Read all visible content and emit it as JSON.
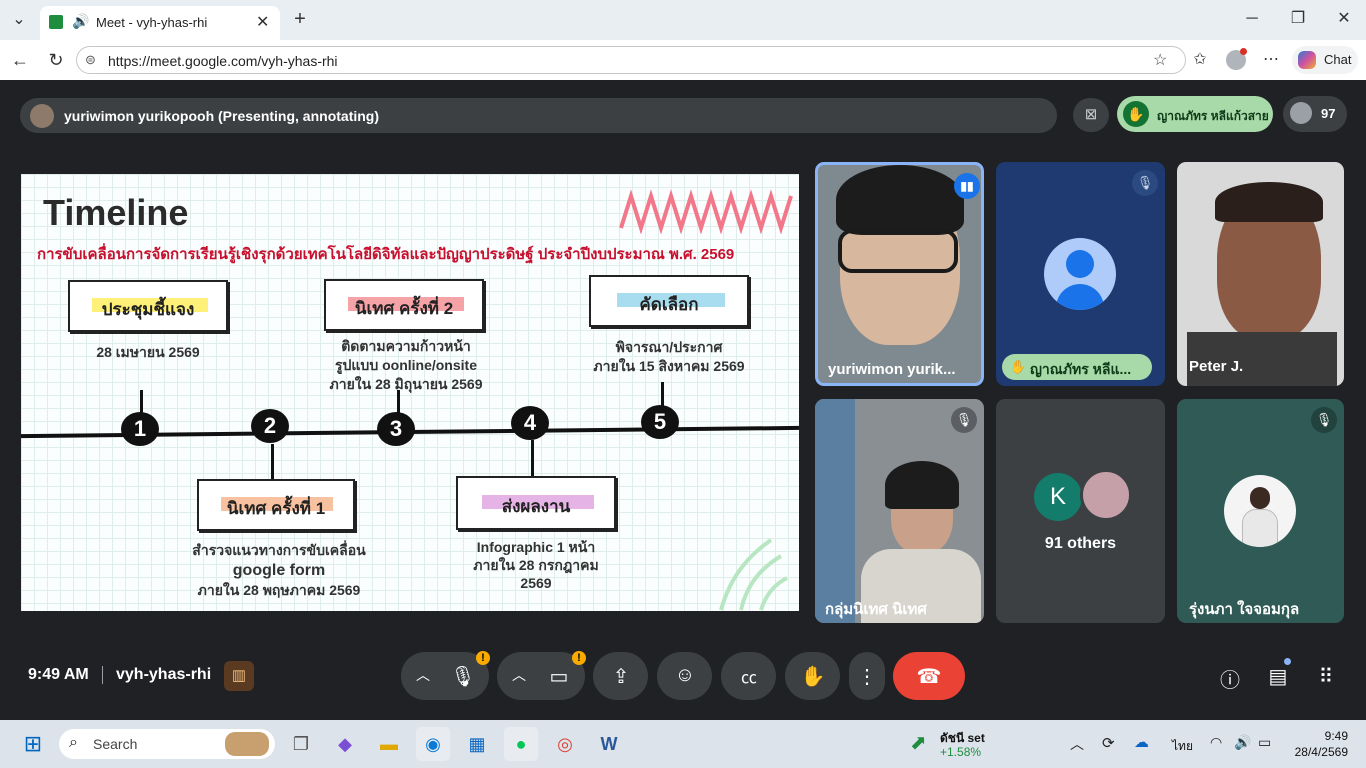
{
  "browser": {
    "tab_title": "Meet - vyh-yhas-rhi",
    "url": "https://meet.google.com/vyh-yhas-rhi",
    "chat_label": "Chat"
  },
  "meet": {
    "presenter": "yuriwimon yurikopooh (Presenting, annotating)",
    "hand_raised_name": "ญาณภัทร หลีแก้วสาย",
    "participant_count": "97",
    "time": "9:49 AM",
    "meeting_code": "vyh-yhas-rhi"
  },
  "slide": {
    "title": "Timeline",
    "subtitle": "การขับเคลื่อนการจัดการเรียนรู้เชิงรุกด้วยเทคโนโลยีดิจิทัลและปัญญาประดิษฐ์ ประจำปีงบประมาณ พ.ศ. 2569",
    "steps": [
      {
        "num": "1",
        "title": "ประชุมชี้แจง",
        "lines": [
          "28 เมษายน 2569"
        ]
      },
      {
        "num": "2",
        "title": "นิเทศ ครั้งที่ 1",
        "lines": [
          "สำรวจแนวทางการขับเคลื่อน",
          "google form",
          "ภายใน 28 พฤษภาคม 2569"
        ]
      },
      {
        "num": "3",
        "title": "นิเทศ ครั้งที่ 2",
        "lines": [
          "ติดตามความก้าวหน้า",
          "รูปแบบ oonline/onsite",
          "ภายใน 28 มิถุนายน 2569"
        ]
      },
      {
        "num": "4",
        "title": "ส่งผลงาน",
        "lines": [
          "Infographic 1 หน้า",
          "ภายใน 28 กรกฎาคม",
          "2569"
        ]
      },
      {
        "num": "5",
        "title": "คัดเลือก",
        "lines": [
          "พิจารณา/ประกาศ",
          "ภายใน 15 สิงหาคม 2569"
        ]
      }
    ],
    "colors": {
      "title_red": "#c8102e",
      "hl_yellow": "#fff07a",
      "hl_pink": "#f6a3a8",
      "hl_blue": "#a8dcef",
      "hl_purple": "#e6b3e6",
      "hl_orange": "#f8c2a0"
    }
  },
  "tiles": [
    {
      "name": "yuriwimon yurik...",
      "state": "speaking"
    },
    {
      "name": "ญาณภัทร หลีแ...",
      "state": "hand-raised",
      "avatar": "person-avatar-icon"
    },
    {
      "name": "Peter J.",
      "state": "camera"
    },
    {
      "name": "กลุ่มนิเทศ นิเทศ",
      "state": "muted"
    },
    {
      "name": "91 others",
      "initial": "K"
    },
    {
      "name": "รุ่งนภา ใจจอมกุล",
      "state": "muted"
    }
  ],
  "taskbar": {
    "search": "Search",
    "stock_name": "ดัชนี set",
    "stock_change": "+1.58%",
    "lang": "ไทย",
    "clock_time": "9:49",
    "clock_date": "28/4/2569"
  }
}
